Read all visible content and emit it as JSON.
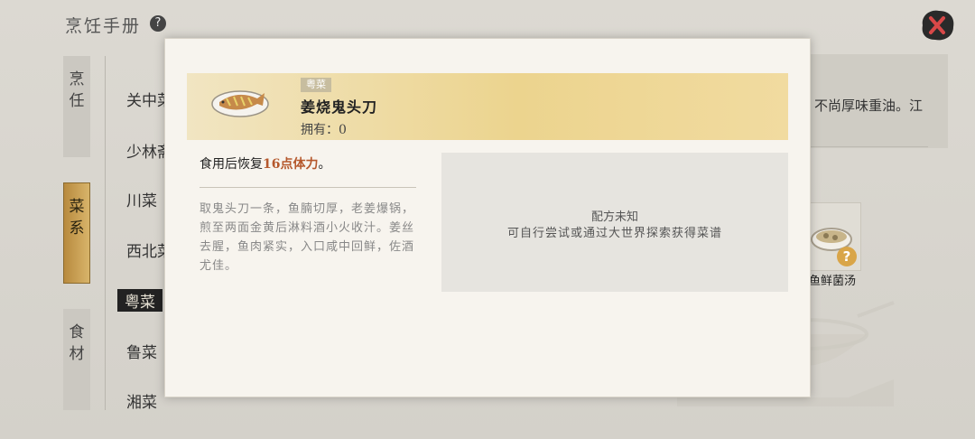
{
  "header": {
    "title": "烹饪手册",
    "help_icon": "?"
  },
  "sidebar": {
    "tabs": [
      {
        "label": "烹\n任",
        "active": false
      },
      {
        "label": "菜\n系",
        "active": true
      },
      {
        "label": "食\n材",
        "active": false
      }
    ]
  },
  "regions": [
    {
      "label": "关中菜",
      "selected": false
    },
    {
      "label": "少林斋",
      "selected": false
    },
    {
      "label": "川菜",
      "selected": false
    },
    {
      "label": "西北菜",
      "selected": false
    },
    {
      "label": "粤菜",
      "selected": true
    },
    {
      "label": "鲁菜",
      "selected": false
    },
    {
      "label": "湘菜",
      "selected": false
    }
  ],
  "background_panel": {
    "desc": "不尚厚味重油。江",
    "dish_name": "鱼鲜菌汤",
    "unknown_badge": "?"
  },
  "modal": {
    "cuisine_tag": "粤菜",
    "dish_title": "姜烧鬼头刀",
    "owned_label": "拥有：0",
    "restore_prefix": "食用后恢复",
    "restore_highlight": "16点体力",
    "restore_suffix": "。",
    "description": "取鬼头刀一条，鱼腩切厚，老姜爆锅，煎至两面金黄后淋料酒小火收汁。姜丝去腥，鱼肉紧实，入口咸中回鲜，佐酒尤佳。",
    "recipe_title": "配方未知",
    "recipe_hint": "可自行尝试或通过大世界探索获得菜谱"
  },
  "colors": {
    "accent_gold": "#d8b46a",
    "highlight_orange": "#b5582c",
    "banner_gold": "#ecd48e"
  }
}
